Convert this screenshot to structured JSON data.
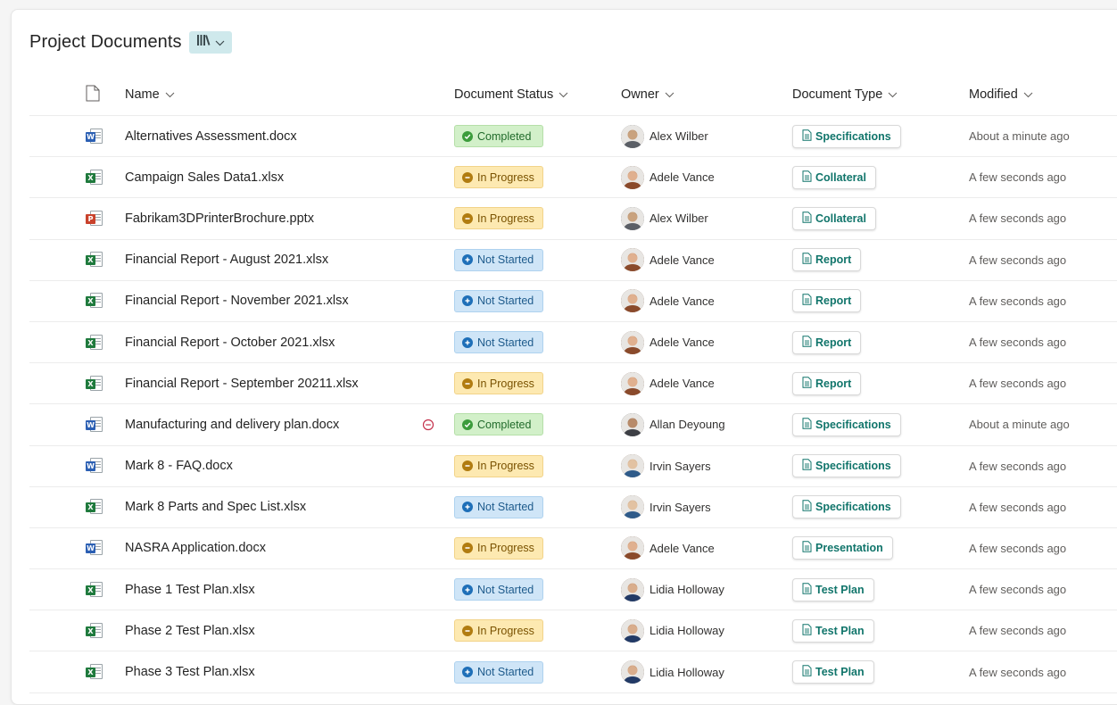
{
  "page": {
    "title": "Project Documents",
    "view_icon": "library-icon"
  },
  "columns": {
    "file_type": "file-icon",
    "name": "Name",
    "status": "Document Status",
    "owner": "Owner",
    "type": "Document Type",
    "modified": "Modified"
  },
  "colors": {
    "accent": "#11756b",
    "completed": "#3c9c3c",
    "in_progress": "#b17c10",
    "not_started": "#1e6fb8",
    "word": "#2b5fb3",
    "excel": "#1f7a3d",
    "powerpoint": "#c9422c"
  },
  "rows": [
    {
      "kind": "word",
      "name": "Alternatives Assessment.docx",
      "status": "Completed",
      "status_key": "completed",
      "owner": "Alex Wilber",
      "owner_avatar": "alex",
      "type": "Specifications",
      "modified": "About a minute ago",
      "warning": false
    },
    {
      "kind": "excel",
      "name": "Campaign Sales Data1.xlsx",
      "status": "In Progress",
      "status_key": "inprogress",
      "owner": "Adele Vance",
      "owner_avatar": "adele",
      "type": "Collateral",
      "modified": "A few seconds ago",
      "warning": false
    },
    {
      "kind": "powerpoint",
      "name": "Fabrikam3DPrinterBrochure.pptx",
      "status": "In Progress",
      "status_key": "inprogress",
      "owner": "Alex Wilber",
      "owner_avatar": "alex",
      "type": "Collateral",
      "modified": "A few seconds ago",
      "warning": false
    },
    {
      "kind": "excel",
      "name": "Financial Report - August 2021.xlsx",
      "status": "Not Started",
      "status_key": "notstarted",
      "owner": "Adele Vance",
      "owner_avatar": "adele",
      "type": "Report",
      "modified": "A few seconds ago",
      "warning": false
    },
    {
      "kind": "excel",
      "name": "Financial Report - November 2021.xlsx",
      "status": "Not Started",
      "status_key": "notstarted",
      "owner": "Adele Vance",
      "owner_avatar": "adele",
      "type": "Report",
      "modified": "A few seconds ago",
      "warning": false
    },
    {
      "kind": "excel",
      "name": "Financial Report - October 2021.xlsx",
      "status": "Not Started",
      "status_key": "notstarted",
      "owner": "Adele Vance",
      "owner_avatar": "adele",
      "type": "Report",
      "modified": "A few seconds ago",
      "warning": false
    },
    {
      "kind": "excel",
      "name": "Financial Report - September 20211.xlsx",
      "status": "In Progress",
      "status_key": "inprogress",
      "owner": "Adele Vance",
      "owner_avatar": "adele",
      "type": "Report",
      "modified": "A few seconds ago",
      "warning": false
    },
    {
      "kind": "word",
      "name": "Manufacturing and delivery plan.docx",
      "status": "Completed",
      "status_key": "completed",
      "owner": "Allan Deyoung",
      "owner_avatar": "allan",
      "type": "Specifications",
      "modified": "About a minute ago",
      "warning": true
    },
    {
      "kind": "word",
      "name": "Mark 8 - FAQ.docx",
      "status": "In Progress",
      "status_key": "inprogress",
      "owner": "Irvin Sayers",
      "owner_avatar": "irvin",
      "type": "Specifications",
      "modified": "A few seconds ago",
      "warning": false
    },
    {
      "kind": "excel",
      "name": "Mark 8 Parts and Spec List.xlsx",
      "status": "Not Started",
      "status_key": "notstarted",
      "owner": "Irvin Sayers",
      "owner_avatar": "irvin",
      "type": "Specifications",
      "modified": "A few seconds ago",
      "warning": false
    },
    {
      "kind": "word",
      "name": "NASRA Application.docx",
      "status": "In Progress",
      "status_key": "inprogress",
      "owner": "Adele Vance",
      "owner_avatar": "adele",
      "type": "Presentation",
      "modified": "A few seconds ago",
      "warning": false
    },
    {
      "kind": "excel",
      "name": "Phase 1 Test Plan.xlsx",
      "status": "Not Started",
      "status_key": "notstarted",
      "owner": "Lidia Holloway",
      "owner_avatar": "lidia",
      "type": "Test Plan",
      "modified": "A few seconds ago",
      "warning": false
    },
    {
      "kind": "excel",
      "name": "Phase 2 Test Plan.xlsx",
      "status": "In Progress",
      "status_key": "inprogress",
      "owner": "Lidia Holloway",
      "owner_avatar": "lidia",
      "type": "Test Plan",
      "modified": "A few seconds ago",
      "warning": false
    },
    {
      "kind": "excel",
      "name": "Phase 3 Test Plan.xlsx",
      "status": "Not Started",
      "status_key": "notstarted",
      "owner": "Lidia Holloway",
      "owner_avatar": "lidia",
      "type": "Test Plan",
      "modified": "A few seconds ago",
      "warning": false
    }
  ]
}
